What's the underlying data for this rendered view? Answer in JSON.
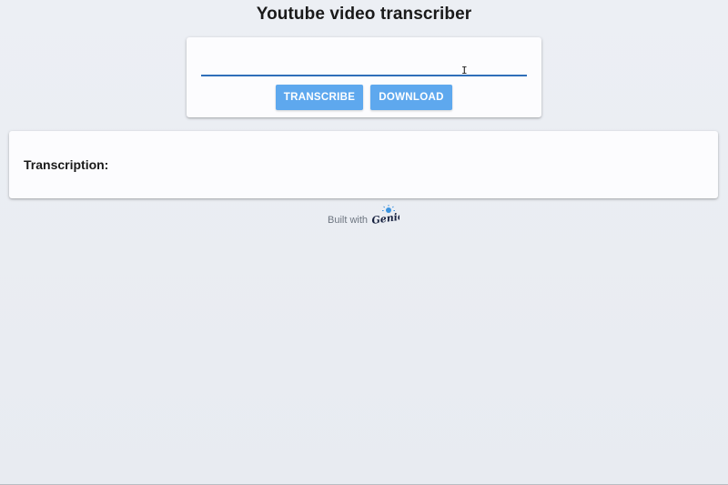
{
  "page": {
    "title": "Youtube video transcriber"
  },
  "form": {
    "url_value": "",
    "url_placeholder": "",
    "transcribe_label": "TRANSCRIBE",
    "download_label": "DOWNLOAD"
  },
  "result": {
    "label": "Transcription:",
    "text": ""
  },
  "footer": {
    "built_with_label": "Built with",
    "logo_text": "Genie",
    "logo_icon": "genie-lamp-icon"
  },
  "colors": {
    "background": "#e9edf3",
    "card": "#fcfcfe",
    "button": "#5ea8ee",
    "input_underline": "#2f6fb9",
    "footer_text": "#6e7681",
    "logo_dark": "#17213f",
    "logo_accent": "#3b93df"
  }
}
